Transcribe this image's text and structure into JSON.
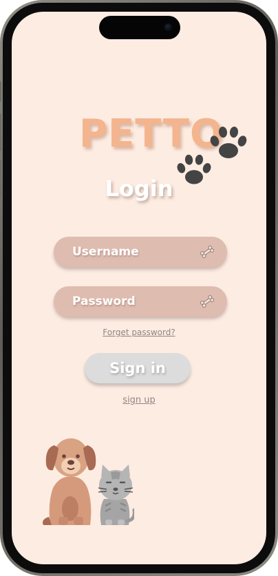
{
  "app": {
    "logo_text": "PETTO",
    "title": "Login"
  },
  "form": {
    "username_placeholder": "Username",
    "password_placeholder": "Password",
    "forgot_label": "Forget password?",
    "signin_label": "Sign in",
    "signup_label": "sign up"
  },
  "icons": {
    "paw": "paw-icon",
    "bone": "bone-icon",
    "illustration": "dog-and-cat-illustration"
  },
  "colors": {
    "background": "#fdece2",
    "logo": "#f3b48e",
    "field": "#dfbcb0",
    "button": "#dcdcdc",
    "paw": "#444444"
  }
}
